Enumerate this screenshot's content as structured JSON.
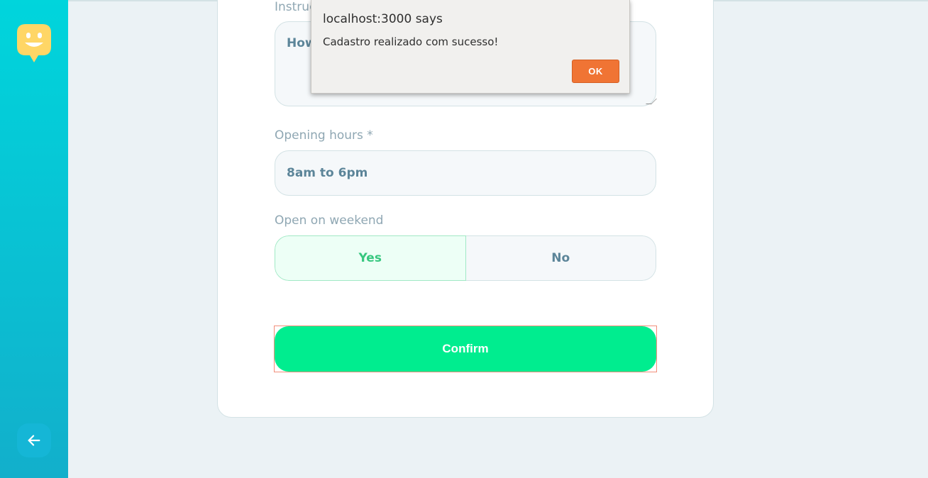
{
  "form": {
    "instructions_label": "Instructions",
    "instructions_value": "How",
    "opening_hours_label": "Opening hours *",
    "opening_hours_value": "8am to 6pm",
    "weekend_label": "Open on weekend",
    "weekend_yes": "Yes",
    "weekend_no": "No",
    "weekend_selected": "Yes",
    "confirm_label": "Confirm"
  },
  "sidebar": {
    "logo_icon": "smiley-face-icon",
    "back_icon": "arrow-left-icon"
  },
  "dialog": {
    "title": "localhost:3000 says",
    "message": "Cadastro realizado com sucesso!",
    "ok_label": "OK"
  },
  "colors": {
    "sidebar_top": "#00d5dc",
    "sidebar_bottom": "#12afcb",
    "logo_yellow": "#ffd666",
    "confirm_green": "#00ed8f",
    "selected_green": "#37c77f",
    "ok_orange": "#f07434"
  }
}
